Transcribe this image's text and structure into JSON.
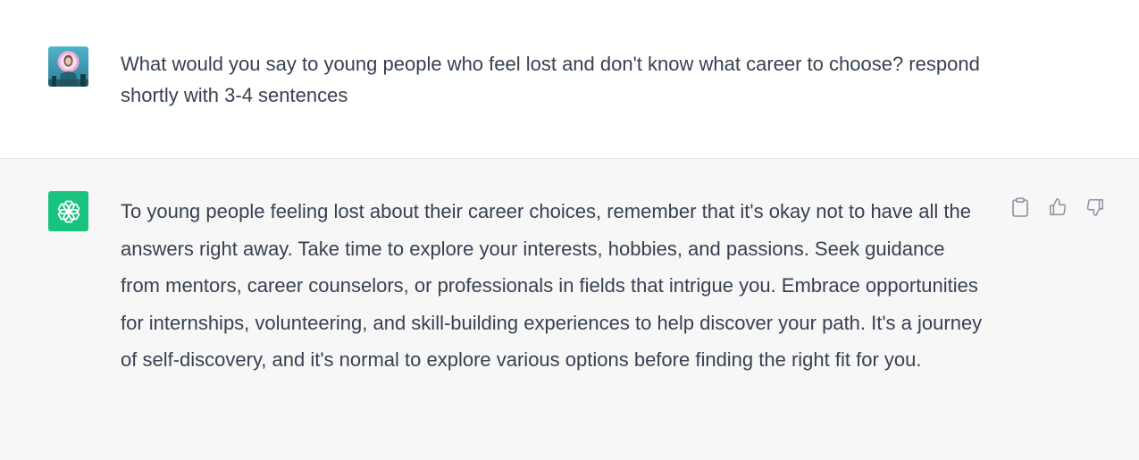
{
  "conversation": {
    "user_message": {
      "avatar_icon": "user-photo-avatar-icon",
      "text": "What would you say to young people who feel lost and don't know what career to choose? respond shortly with 3-4 sentences"
    },
    "assistant_message": {
      "avatar_icon": "openai-logo-icon",
      "avatar_color": "#19c37d",
      "text": "To young people feeling lost about their career choices, remember that it's okay not to have all the answers right away. Take time to explore your interests, hobbies, and passions. Seek guidance from mentors, career counselors, or professionals in fields that intrigue you. Embrace opportunities for internships, volunteering, and skill-building experiences to help discover your path. It's a journey of self-discovery, and it's normal to explore various options before finding the right fit for you.",
      "actions": [
        "copy-icon",
        "thumbs-up-icon",
        "thumbs-down-icon"
      ]
    }
  },
  "colors": {
    "assistant_background": "#f7f7f8",
    "text": "#374151",
    "action_icon": "#8e8ea0"
  }
}
